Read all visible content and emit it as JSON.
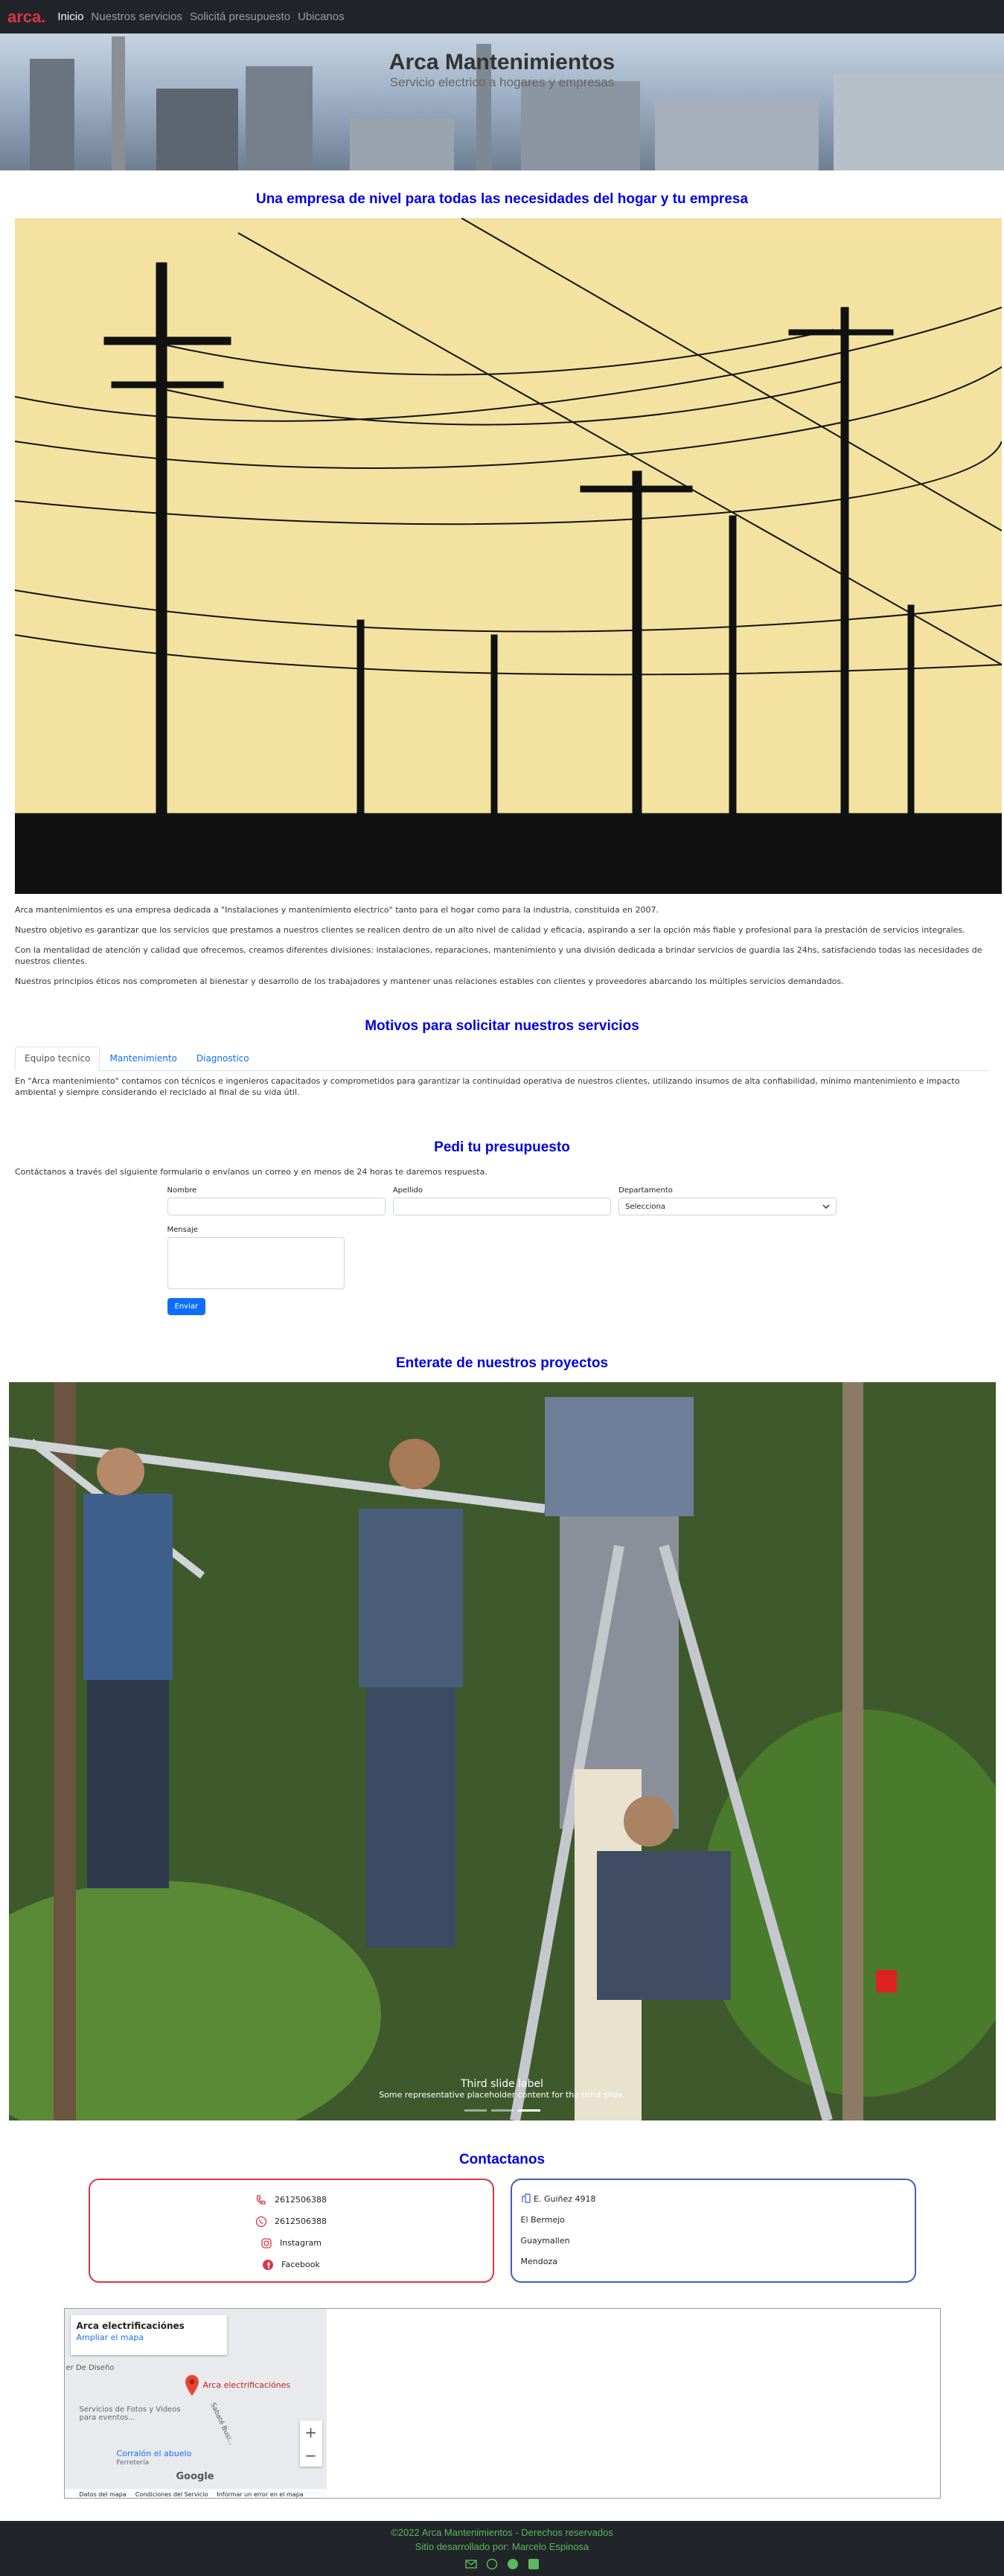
{
  "nav": {
    "brand": "arca.",
    "links": [
      "Inicio",
      "Nuestros servicios",
      "Solicitá presupuesto",
      "Ubicanos"
    ]
  },
  "hero": {
    "title": "Arca Mantenimientos",
    "subtitle": "Servicio electrico a hogares y empresas"
  },
  "intro": {
    "title": "Una empresa de nivel para todas las necesidades del hogar y tu empresa",
    "paragraphs": [
      "Arca mantenimientos es una empresa dedicada a \"Instalaciones y mantenimiento electrico\" tanto para el hogar como para la industria, constituida en 2007.",
      "Nuestro objetivo es garantizar que los servicios que prestamos a nuestros clientes se realicen dentro de un alto nivel de calidad y eficacia, aspirando a ser la opción más fiable y profesional para la prestación de servicios integrales.",
      "Con la mentalidad de atención y calidad que ofrecemos, creamos diferentes divisiones: instalaciones, reparaciones, mantenimiento y una división dedicada a brindar servicios de guardia las 24hs, satisfaciendo todas las necesidades de nuestros clientes.",
      "Nuestros principios éticos nos comprometen al bienestar y desarrollo de los trabajadores y mantener unas relaciones estables con clientes y proveedores abarcando los múltiples servicios demandados."
    ]
  },
  "motivos": {
    "title": "Motivos para solicitar nuestros servicios",
    "tabs": [
      "Equipo tecnico",
      "Mantenimiento",
      "Diagnostico"
    ],
    "text": "En \"Arca mantenimiento\" contamos con técnicos e ingenieros capacitados y comprometidos para garantizar la continuidad operativa de nuestros clientes, utilizando insumos de alta confiabilidad, mínimo mantenimiento e impacto ambiental y siempre considerando el reciclado al final de su vida útil."
  },
  "presupuesto": {
    "title": "Pedi tu presupuesto",
    "intro": "Contáctanos a través del siguiente formulario o envíanos un correo y en menos de 24 horas te daremos respuesta.",
    "nombre_label": "Nombre",
    "apellido_label": "Apellido",
    "departamento_label": "Departamento",
    "departamento_value": "Selecciona",
    "mensaje_label": "Mensaje",
    "submit": "Enviar"
  },
  "proyectos": {
    "title": "Enterate de nuestros proyectos",
    "caption_title": "Third slide label",
    "caption_text": "Some representative placeholder content for the third slide."
  },
  "contacto": {
    "title": "Contactanos",
    "phone1": "2612506388",
    "whatsapp": "2612506388",
    "instagram": "Instagram",
    "facebook": "Facebook",
    "address": [
      "E. Guiñez 4918",
      "El Bermejo",
      "Guaymallen",
      "Mendoza"
    ]
  },
  "map": {
    "place_title": "Arca electrificaciónes",
    "enlarge": "Ampliar el mapa",
    "pin_label": "Arca electrificaciónes",
    "labels": [
      "er De Diseño",
      "Servicios de Fotos y Videos para eventos...",
      "Corralón el abuelo",
      "Ferretería",
      "Sabaté Busi..."
    ],
    "bottom": [
      "Datos del mapa",
      "Condiciones del Servicio",
      "Informar un error en el mapa"
    ],
    "google": "Google"
  },
  "footer": {
    "line1": "©2022 Arca Mantenimientos - Derechos reservados",
    "line2": "Sitio desarrollado por: Marcelo Espinosa"
  }
}
